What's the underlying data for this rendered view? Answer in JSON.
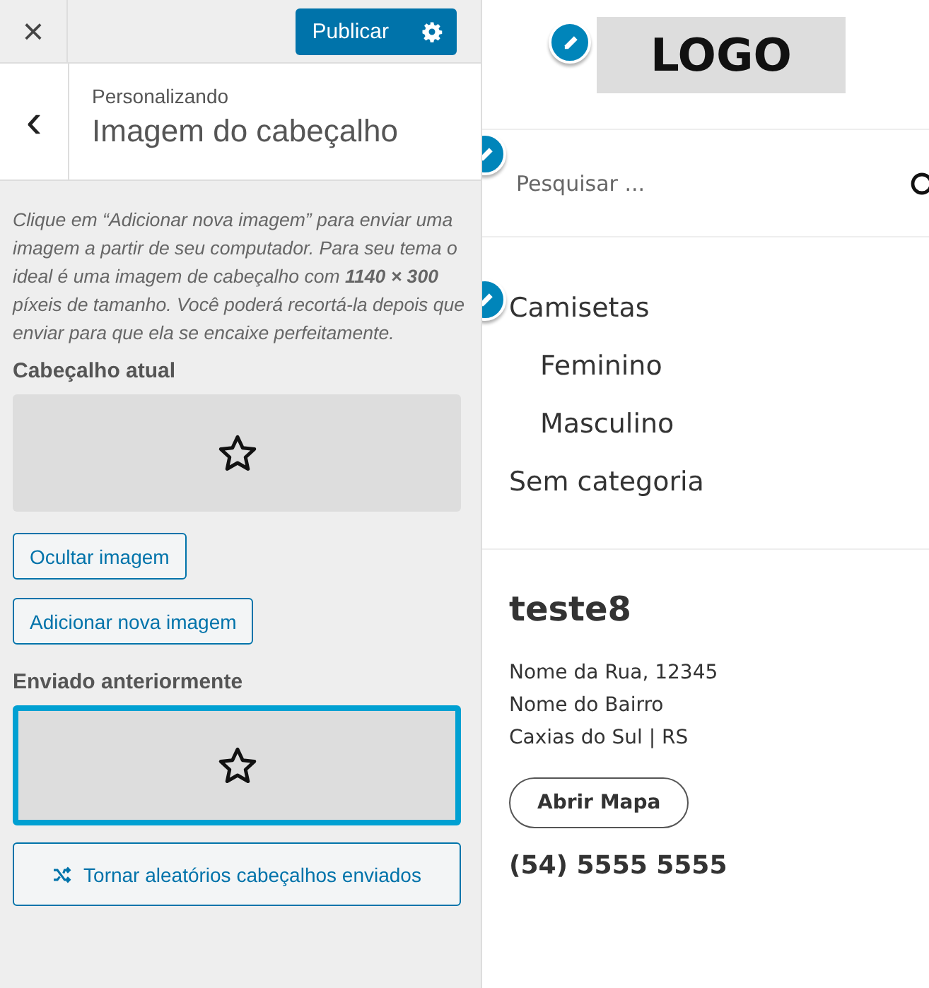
{
  "customizer": {
    "close": "×",
    "publish_button": "Publicar",
    "breadcrumb": "Personalizando",
    "section_title": "Imagem do cabeçalho",
    "back": "‹",
    "description": "Clique em “Adicionar nova imagem” para enviar uma imagem a partir de seu computador. Para seu tema o ideal é uma imagem de cabeçalho com **1140 × 300** píxeis de tamanho. Você poderá recortá-la depois que enviar para que ela se encaixe perfeitamente.",
    "current_header": {
      "label": "Cabeçalho atual",
      "selected": false
    },
    "buttons": [
      "Ocultar imagem",
      "Adicionar nova imagem"
    ],
    "uploaded": {
      "label": "Enviado anteriormente",
      "images": [
        {
          "selected": true
        }
      ]
    },
    "randomize_button": "Tornar aleatórios cabeçalhos enviados"
  },
  "preview": {
    "logo": "LOGO",
    "search": {
      "placeholder": "Pesquisar ..."
    },
    "categories": [
      {
        "label": "Camisetas",
        "children": [
          {
            "label": "Feminino"
          },
          {
            "label": "Masculino"
          }
        ]
      },
      {
        "label": "Sem categoria"
      }
    ],
    "store": {
      "name": "teste8",
      "address": [
        "Nome da Rua, 12345",
        "Nome do Bairro",
        "Caxias do Sul | RS"
      ],
      "map_button": "Abrir Mapa",
      "phone": "(54) 5555 5555"
    }
  }
}
